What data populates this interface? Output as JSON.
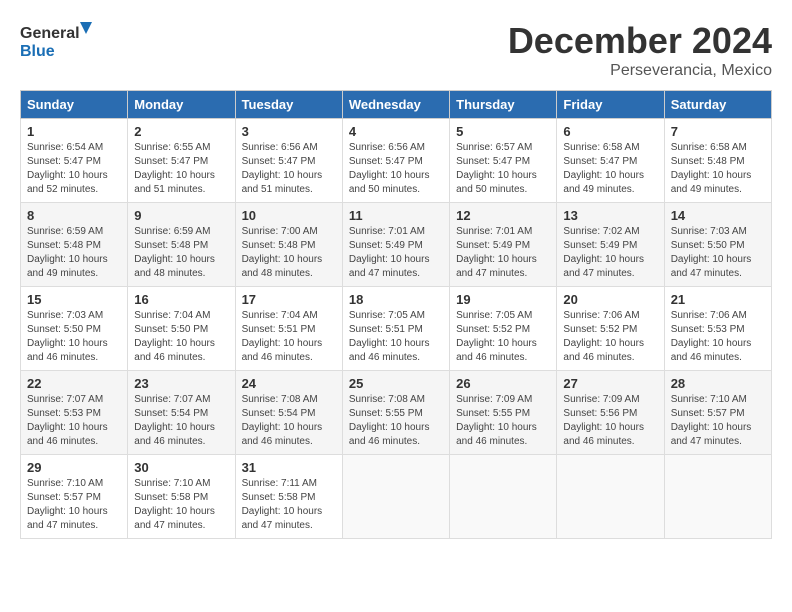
{
  "logo": {
    "general": "General",
    "blue": "Blue"
  },
  "header": {
    "month": "December 2024",
    "location": "Perseverancia, Mexico"
  },
  "weekdays": [
    "Sunday",
    "Monday",
    "Tuesday",
    "Wednesday",
    "Thursday",
    "Friday",
    "Saturday"
  ],
  "weeks": [
    [
      {
        "day": "1",
        "content": "Sunrise: 6:54 AM\nSunset: 5:47 PM\nDaylight: 10 hours\nand 52 minutes."
      },
      {
        "day": "2",
        "content": "Sunrise: 6:55 AM\nSunset: 5:47 PM\nDaylight: 10 hours\nand 51 minutes."
      },
      {
        "day": "3",
        "content": "Sunrise: 6:56 AM\nSunset: 5:47 PM\nDaylight: 10 hours\nand 51 minutes."
      },
      {
        "day": "4",
        "content": "Sunrise: 6:56 AM\nSunset: 5:47 PM\nDaylight: 10 hours\nand 50 minutes."
      },
      {
        "day": "5",
        "content": "Sunrise: 6:57 AM\nSunset: 5:47 PM\nDaylight: 10 hours\nand 50 minutes."
      },
      {
        "day": "6",
        "content": "Sunrise: 6:58 AM\nSunset: 5:47 PM\nDaylight: 10 hours\nand 49 minutes."
      },
      {
        "day": "7",
        "content": "Sunrise: 6:58 AM\nSunset: 5:48 PM\nDaylight: 10 hours\nand 49 minutes."
      }
    ],
    [
      {
        "day": "8",
        "content": "Sunrise: 6:59 AM\nSunset: 5:48 PM\nDaylight: 10 hours\nand 49 minutes."
      },
      {
        "day": "9",
        "content": "Sunrise: 6:59 AM\nSunset: 5:48 PM\nDaylight: 10 hours\nand 48 minutes."
      },
      {
        "day": "10",
        "content": "Sunrise: 7:00 AM\nSunset: 5:48 PM\nDaylight: 10 hours\nand 48 minutes."
      },
      {
        "day": "11",
        "content": "Sunrise: 7:01 AM\nSunset: 5:49 PM\nDaylight: 10 hours\nand 47 minutes."
      },
      {
        "day": "12",
        "content": "Sunrise: 7:01 AM\nSunset: 5:49 PM\nDaylight: 10 hours\nand 47 minutes."
      },
      {
        "day": "13",
        "content": "Sunrise: 7:02 AM\nSunset: 5:49 PM\nDaylight: 10 hours\nand 47 minutes."
      },
      {
        "day": "14",
        "content": "Sunrise: 7:03 AM\nSunset: 5:50 PM\nDaylight: 10 hours\nand 47 minutes."
      }
    ],
    [
      {
        "day": "15",
        "content": "Sunrise: 7:03 AM\nSunset: 5:50 PM\nDaylight: 10 hours\nand 46 minutes."
      },
      {
        "day": "16",
        "content": "Sunrise: 7:04 AM\nSunset: 5:50 PM\nDaylight: 10 hours\nand 46 minutes."
      },
      {
        "day": "17",
        "content": "Sunrise: 7:04 AM\nSunset: 5:51 PM\nDaylight: 10 hours\nand 46 minutes."
      },
      {
        "day": "18",
        "content": "Sunrise: 7:05 AM\nSunset: 5:51 PM\nDaylight: 10 hours\nand 46 minutes."
      },
      {
        "day": "19",
        "content": "Sunrise: 7:05 AM\nSunset: 5:52 PM\nDaylight: 10 hours\nand 46 minutes."
      },
      {
        "day": "20",
        "content": "Sunrise: 7:06 AM\nSunset: 5:52 PM\nDaylight: 10 hours\nand 46 minutes."
      },
      {
        "day": "21",
        "content": "Sunrise: 7:06 AM\nSunset: 5:53 PM\nDaylight: 10 hours\nand 46 minutes."
      }
    ],
    [
      {
        "day": "22",
        "content": "Sunrise: 7:07 AM\nSunset: 5:53 PM\nDaylight: 10 hours\nand 46 minutes."
      },
      {
        "day": "23",
        "content": "Sunrise: 7:07 AM\nSunset: 5:54 PM\nDaylight: 10 hours\nand 46 minutes."
      },
      {
        "day": "24",
        "content": "Sunrise: 7:08 AM\nSunset: 5:54 PM\nDaylight: 10 hours\nand 46 minutes."
      },
      {
        "day": "25",
        "content": "Sunrise: 7:08 AM\nSunset: 5:55 PM\nDaylight: 10 hours\nand 46 minutes."
      },
      {
        "day": "26",
        "content": "Sunrise: 7:09 AM\nSunset: 5:55 PM\nDaylight: 10 hours\nand 46 minutes."
      },
      {
        "day": "27",
        "content": "Sunrise: 7:09 AM\nSunset: 5:56 PM\nDaylight: 10 hours\nand 46 minutes."
      },
      {
        "day": "28",
        "content": "Sunrise: 7:10 AM\nSunset: 5:57 PM\nDaylight: 10 hours\nand 47 minutes."
      }
    ],
    [
      {
        "day": "29",
        "content": "Sunrise: 7:10 AM\nSunset: 5:57 PM\nDaylight: 10 hours\nand 47 minutes."
      },
      {
        "day": "30",
        "content": "Sunrise: 7:10 AM\nSunset: 5:58 PM\nDaylight: 10 hours\nand 47 minutes."
      },
      {
        "day": "31",
        "content": "Sunrise: 7:11 AM\nSunset: 5:58 PM\nDaylight: 10 hours\nand 47 minutes."
      },
      {
        "day": "",
        "content": ""
      },
      {
        "day": "",
        "content": ""
      },
      {
        "day": "",
        "content": ""
      },
      {
        "day": "",
        "content": ""
      }
    ]
  ]
}
